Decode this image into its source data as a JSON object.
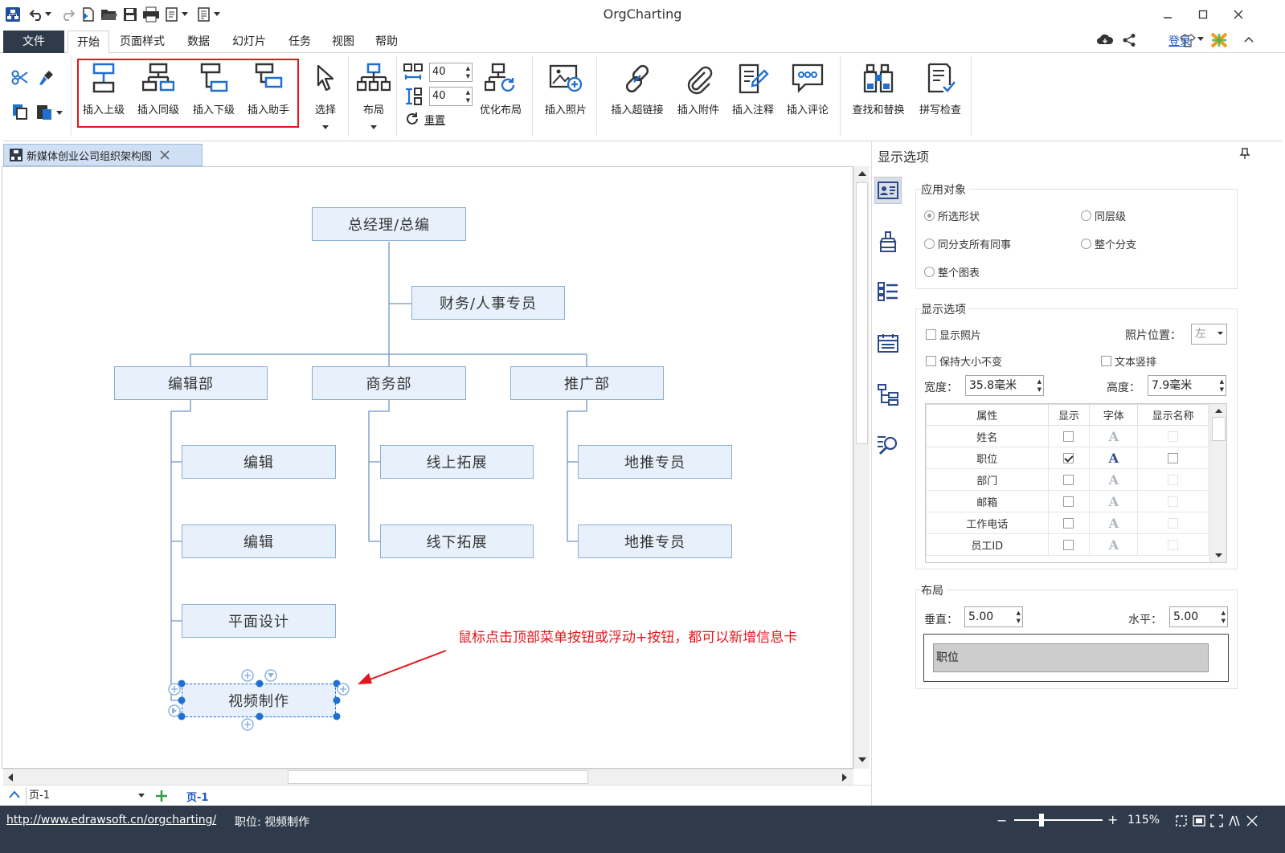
{
  "app": {
    "title": "OrgCharting"
  },
  "menu": {
    "file": "文件",
    "tabs": [
      "开始",
      "页面样式",
      "数据",
      "幻灯片",
      "任务",
      "视图",
      "帮助"
    ],
    "login": "登录"
  },
  "ribbon": {
    "insert_superior": "插入上级",
    "insert_peer": "插入同级",
    "insert_subordinate": "插入下级",
    "insert_assistant": "插入助手",
    "select": "选择",
    "layout": "布局",
    "spacing_h": "40",
    "spacing_v": "40",
    "reset": "重置",
    "optimize_layout": "优化布局",
    "insert_photo": "插入照片",
    "insert_hyperlink": "插入超链接",
    "insert_attachment": "插入附件",
    "insert_note": "插入注释",
    "insert_comment": "插入评论",
    "find_replace": "查找和替换",
    "spell_check": "拼写检查"
  },
  "document": {
    "tab_title": "新媒体创业公司组织架构图"
  },
  "chart": {
    "root": "总经理/总编",
    "assistant": "财务/人事专员",
    "departments": [
      "编辑部",
      "商务部",
      "推广部"
    ],
    "editorial_children": [
      "编辑",
      "编辑",
      "平面设计",
      "视频制作"
    ],
    "business_children": [
      "线上拓展",
      "线下拓展"
    ],
    "promotion_children": [
      "地推专员",
      "地推专员"
    ],
    "annotation": "鼠标点击顶部菜单按钮或浮动+按钮，都可以新增信息卡"
  },
  "pages": {
    "selector": "页-1",
    "active_tab": "页-1"
  },
  "status": {
    "url": "http://www.edrawsoft.cn/orgcharting/",
    "selection": "职位: 视频制作",
    "zoom": "115%",
    "zoom_level_fraction": 0.3
  },
  "panel": {
    "title": "显示选项",
    "apply_group": "应用对象",
    "apply_options": [
      "所选形状",
      "同层级",
      "同分支所有同事",
      "整个分支",
      "整个图表"
    ],
    "apply_selected": 0,
    "display_group": "显示选项",
    "show_photo": "显示照片",
    "photo_position_label": "照片位置：",
    "photo_position_value": "左",
    "keep_size": "保持大小不变",
    "vertical_text": "文本竖排",
    "width_label": "宽度：",
    "width_value": "35.8毫米",
    "height_label": "高度：",
    "height_value": "7.9毫米",
    "table_headers": [
      "属性",
      "显示",
      "字体",
      "显示名称"
    ],
    "table_rows": [
      {
        "name": "姓名",
        "show": false
      },
      {
        "name": "职位",
        "show": true
      },
      {
        "name": "部门",
        "show": false
      },
      {
        "name": "邮箱",
        "show": false
      },
      {
        "name": "工作电话",
        "show": false
      },
      {
        "name": "员工ID",
        "show": false
      }
    ],
    "font_glyph": "A",
    "layout_group": "布局",
    "vertical_label": "垂直：",
    "vertical_value": "5.00",
    "horizontal_label": "水平：",
    "horizontal_value": "5.00",
    "preview_text": "职位"
  },
  "colors": {
    "accent": "#1a56c4",
    "status_bg": "#2f3a4b",
    "highlight": "#e8141b",
    "node_fill": "#e8f1fb"
  }
}
